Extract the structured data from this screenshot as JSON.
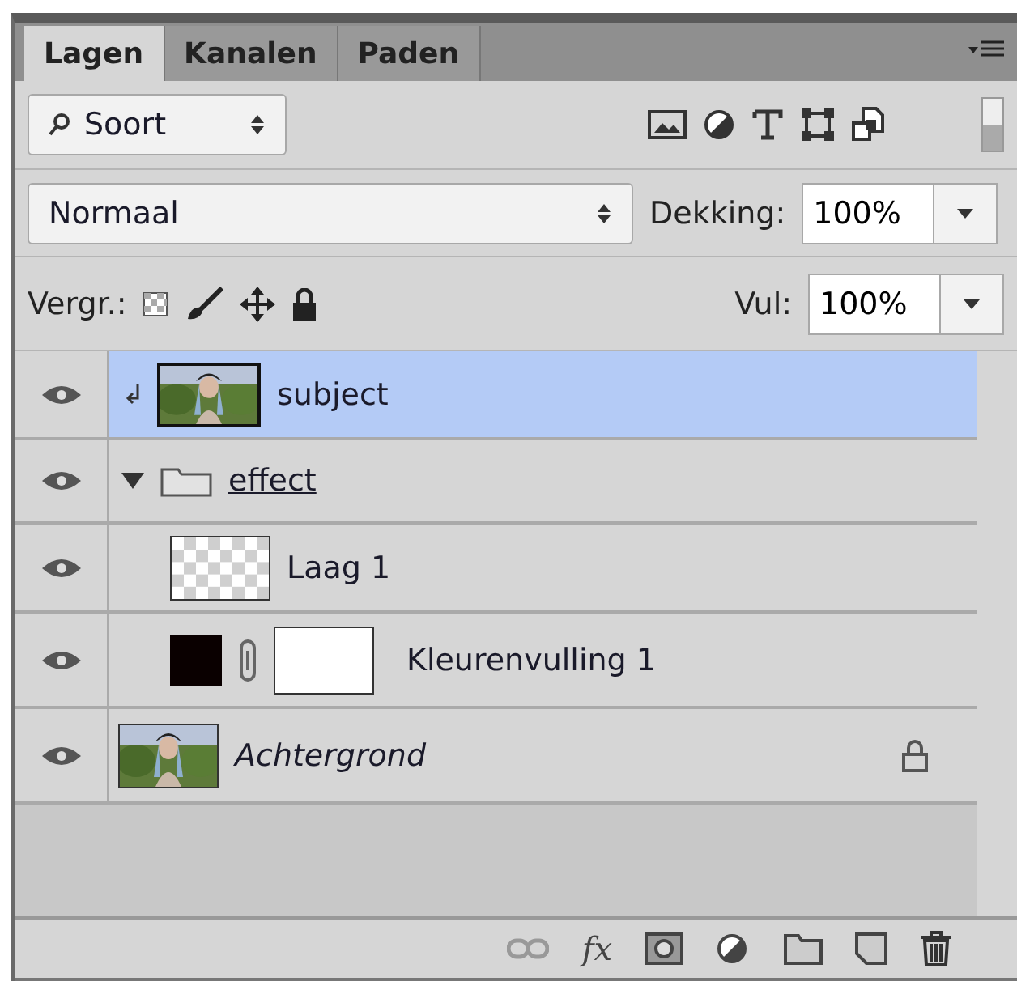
{
  "tabs": [
    {
      "label": "Lagen",
      "selected": true
    },
    {
      "label": "Kanalen",
      "selected": false
    },
    {
      "label": "Paden",
      "selected": false
    }
  ],
  "filter": {
    "value": "Soort"
  },
  "blend": {
    "mode": "Normaal",
    "opacity_label": "Dekking:",
    "opacity": "100%"
  },
  "lock": {
    "label": "Vergr.:",
    "fill_label": "Vul:",
    "fill": "100%"
  },
  "layers": [
    {
      "name": "subject",
      "visible": true,
      "selected": true,
      "clipped": true
    },
    {
      "name": "effect",
      "kind": "group",
      "visible": true,
      "selected": false,
      "expanded": true,
      "children": [
        {
          "name": "Laag 1",
          "kind": "transparent",
          "visible": true,
          "selected": false
        },
        {
          "name": "Kleurenvulling 1",
          "kind": "fill",
          "visible": true,
          "selected": false
        }
      ]
    },
    {
      "name": "Achtergrond",
      "kind": "background",
      "visible": true,
      "selected": false,
      "locked": true
    }
  ],
  "footer": {
    "effects_label": "fx"
  }
}
